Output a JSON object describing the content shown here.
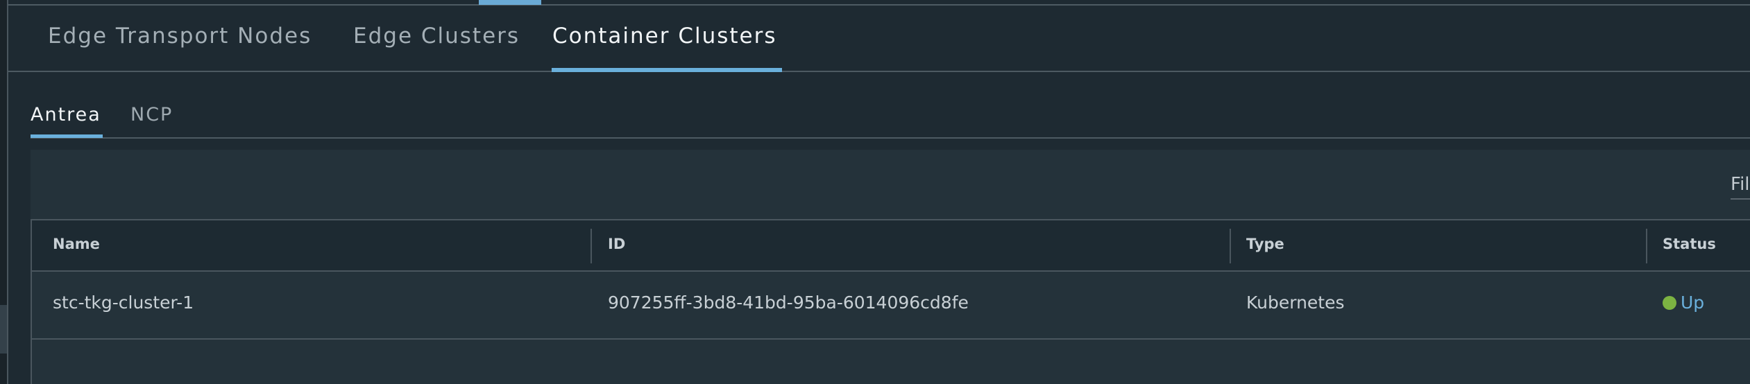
{
  "main_tabs": [
    {
      "label": "Edge Transport Nodes",
      "active": false
    },
    {
      "label": "Edge Clusters",
      "active": false
    },
    {
      "label": "Container Clusters",
      "active": true
    }
  ],
  "sub_tabs": [
    {
      "label": "Antrea",
      "active": true
    },
    {
      "label": "NCP",
      "active": false
    }
  ],
  "filter": {
    "placeholder": "Filter by Name, Path and more"
  },
  "table": {
    "columns": [
      "Name",
      "ID",
      "Type",
      "Status"
    ],
    "rows": [
      {
        "name": "stc-tkg-cluster-1",
        "id": "907255ff-3bd8-41bd-95ba-6014096cd8fe",
        "type": "Kubernetes",
        "status": "Up",
        "status_color": "#7cb342"
      }
    ]
  },
  "colors": {
    "accent": "#6ab0dc",
    "background": "#1e2a32",
    "status_up": "#7cb342"
  }
}
